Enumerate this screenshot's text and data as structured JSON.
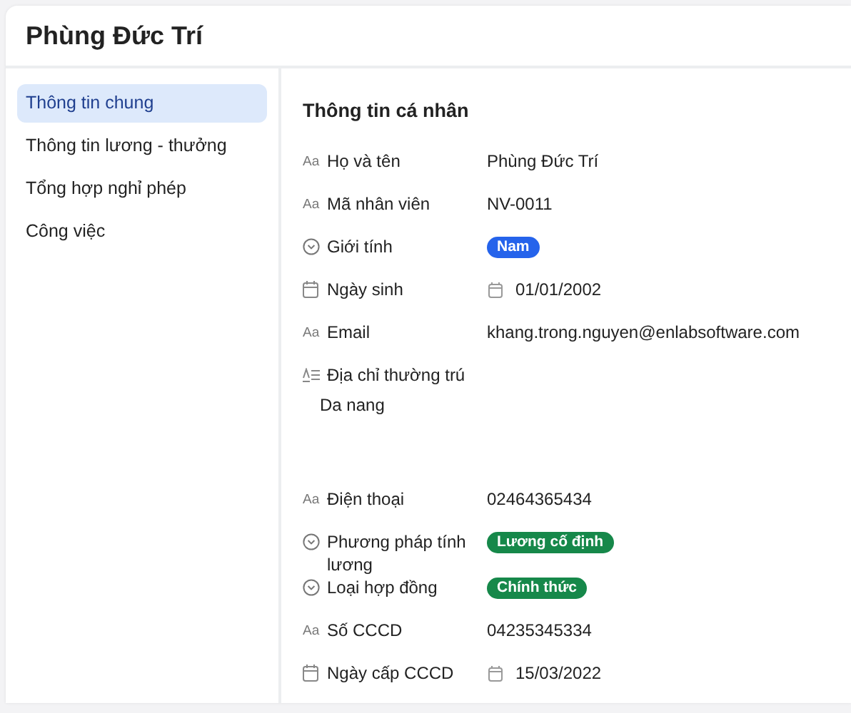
{
  "header": {
    "title": "Phùng Đức Trí"
  },
  "sidebar": {
    "items": [
      {
        "label": "Thông tin chung",
        "selected": true
      },
      {
        "label": "Thông tin lương - thưởng",
        "selected": false
      },
      {
        "label": "Tổng hợp nghỉ phép",
        "selected": false
      },
      {
        "label": "Công việc",
        "selected": false
      }
    ]
  },
  "section": {
    "title": "Thông tin cá nhân",
    "fields": [
      {
        "kind": "text",
        "icon_label": "Aa",
        "label": "Họ và tên",
        "value": "Phùng Đức Trí"
      },
      {
        "kind": "text",
        "icon_label": "Aa",
        "label": "Mã nhân viên",
        "value": "NV-0011"
      },
      {
        "kind": "select",
        "label": "Giới tính",
        "value": "Nam",
        "color": "#2563eb"
      },
      {
        "kind": "date",
        "label": "Ngày sinh",
        "value": "01/01/2002"
      },
      {
        "kind": "text",
        "icon_label": "Aa",
        "label": "Email",
        "value": "khang.trong.nguyen@enlabsoftware.com"
      },
      {
        "kind": "longtext",
        "label": "Địa chỉ thường trú",
        "value": "Da nang"
      },
      {
        "kind": "text",
        "icon_label": "Aa",
        "label": "Điện thoại",
        "value": "02464365434"
      },
      {
        "kind": "select",
        "label": "Phương pháp tính lương",
        "value": "Lương cố định",
        "color": "#16884a"
      },
      {
        "kind": "select",
        "label": "Loại hợp đồng",
        "value": "Chính thức",
        "color": "#16884a"
      },
      {
        "kind": "text",
        "icon_label": "Aa",
        "label": "Số CCCD",
        "value": "04235345334"
      },
      {
        "kind": "date",
        "label": "Ngày cấp CCCD",
        "value": "15/03/2022"
      }
    ]
  }
}
